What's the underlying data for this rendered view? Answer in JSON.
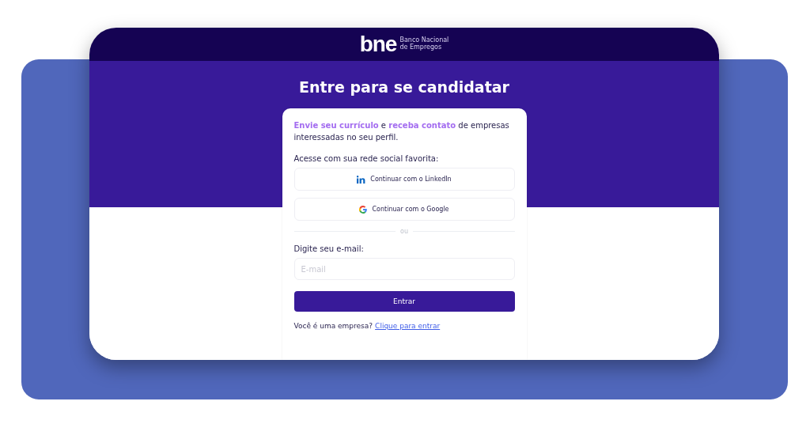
{
  "header": {
    "logo": "bne",
    "logo_caption": [
      "Banco Nacional",
      "de Empregos"
    ]
  },
  "title": "Entre para se candidatar",
  "intro": [
    {
      "text": "Envie seu currículo",
      "highlight": true
    },
    {
      "text": " e ",
      "highlight": false
    },
    {
      "text": "receba contato",
      "highlight": true
    },
    {
      "text": " de empresas interessadas no seu perfil.",
      "highlight": false
    }
  ],
  "social_label": "Acesse com sua rede social favorita:",
  "social_buttons": [
    {
      "kind": "linkedin",
      "label": "Continuar com o LinkedIn"
    },
    {
      "kind": "google",
      "label": "Continuar com o Google"
    }
  ],
  "divider": "ou",
  "email": {
    "label": "Digite seu e-mail:",
    "placeholder": "E-mail"
  },
  "submit": "Entrar",
  "company": {
    "text": "Você é uma empresa?",
    "link": "Clique para entrar"
  }
}
